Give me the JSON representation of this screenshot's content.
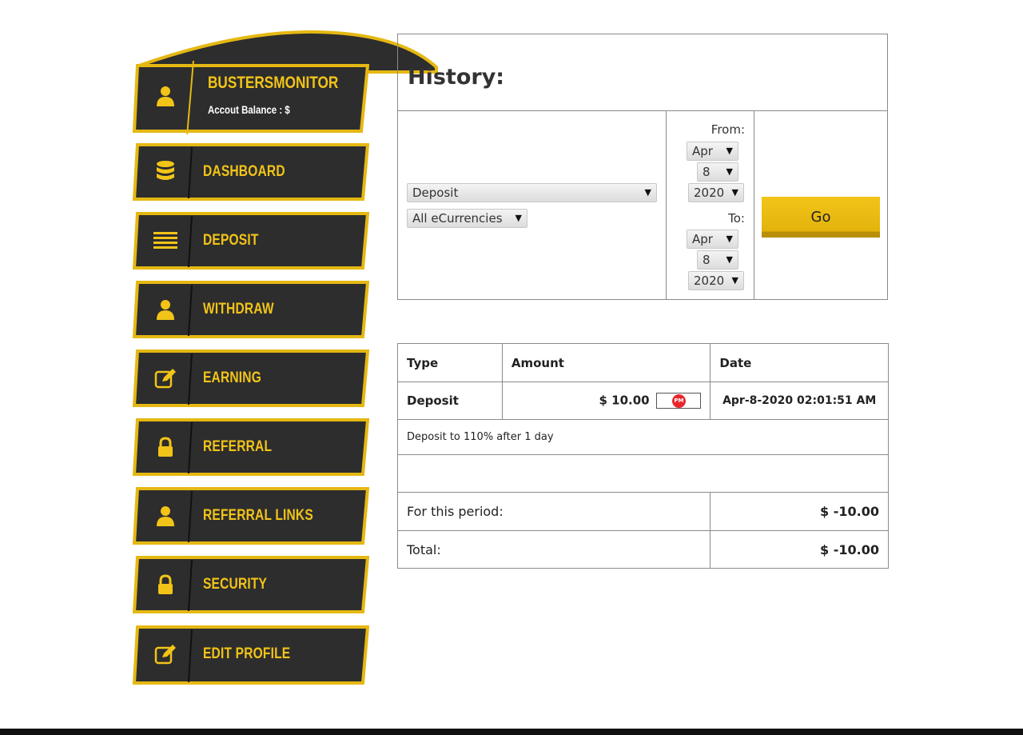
{
  "profile": {
    "username": "BUSTERSMONITOR",
    "balance_label": "Accout Balance : $",
    "icon": "user-icon"
  },
  "sidebar": {
    "items": [
      {
        "label": "DASHBOARD",
        "icon": "database-icon"
      },
      {
        "label": "DEPOSIT",
        "icon": "list-icon"
      },
      {
        "label": "WITHDRAW",
        "icon": "user-icon"
      },
      {
        "label": "EARNING",
        "icon": "edit-icon"
      },
      {
        "label": "REFERRAL",
        "icon": "lock-icon"
      },
      {
        "label": "REFERRAL LINKS",
        "icon": "user-icon"
      },
      {
        "label": "SECURITY",
        "icon": "lock-icon"
      },
      {
        "label": "EDIT PROFILE",
        "icon": "edit-icon"
      }
    ]
  },
  "history": {
    "title": "History:",
    "type_select": "Deposit",
    "currency_select": "All eCurrencies",
    "from_label": "From:",
    "from": {
      "month": "Apr",
      "day": "8",
      "year": "2020"
    },
    "to_label": "To:",
    "to": {
      "month": "Apr",
      "day": "8",
      "year": "2020"
    },
    "go_label": "Go"
  },
  "table": {
    "headers": {
      "type": "Type",
      "amount": "Amount",
      "date": "Date"
    },
    "row": {
      "type": "Deposit",
      "amount": "$ 10.00",
      "badge": "PM",
      "date": "Apr-8-2020 02:01:51 AM",
      "description": "Deposit to 110% after 1 day"
    },
    "period_label": "For this period:",
    "period_value": "$ -10.00",
    "total_label": "Total:",
    "total_value": "$ -10.00"
  },
  "colors": {
    "accent": "#f2c418",
    "panel": "#2d2d2d",
    "badge": "#e8262c"
  }
}
